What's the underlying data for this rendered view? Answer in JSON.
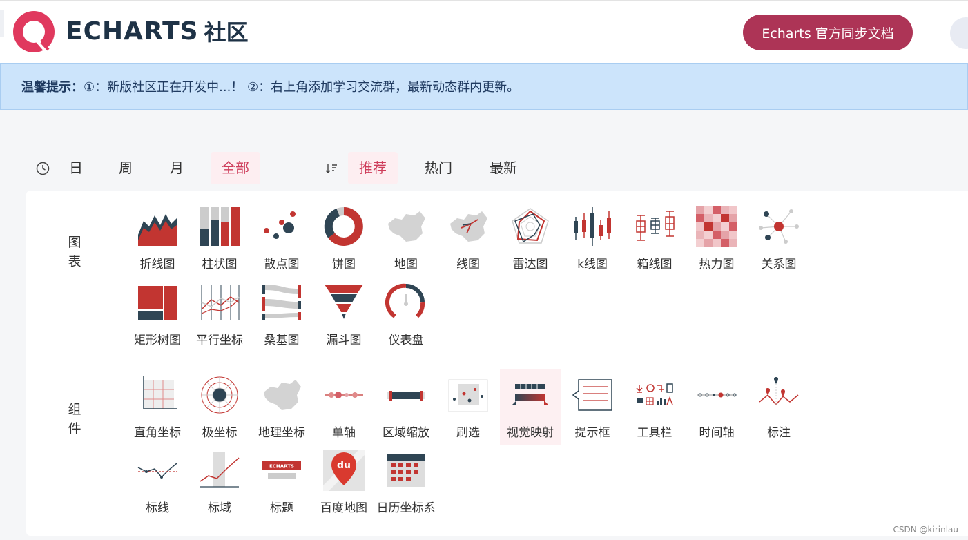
{
  "header": {
    "brand_word": "ECHARTS",
    "brand_cn": "社区",
    "docs_button": "Echarts 官方同步文档"
  },
  "notice": {
    "label": "温馨提示：",
    "text": "①：新版社区正在开发中...！ ②：右上角添加学习交流群，最新动态群内更新。"
  },
  "filters": {
    "time_icon": "clock-icon",
    "time": [
      "日",
      "周",
      "月",
      "全部"
    ],
    "time_active": "全部",
    "sort_icon": "sort-icon",
    "sort": [
      "推荐",
      "热门",
      "最新"
    ],
    "sort_active": "推荐"
  },
  "sections": {
    "charts": {
      "label": "图表",
      "items": [
        "折线图",
        "柱状图",
        "散点图",
        "饼图",
        "地图",
        "线图",
        "雷达图",
        "k线图",
        "箱线图",
        "热力图",
        "关系图",
        "矩形树图",
        "平行坐标",
        "桑基图",
        "漏斗图",
        "仪表盘"
      ]
    },
    "components": {
      "label": "组件",
      "items": [
        "直角坐标",
        "极坐标",
        "地理坐标",
        "单轴",
        "区域缩放",
        "刷选",
        "视觉映射",
        "提示框",
        "工具栏",
        "时间轴",
        "标注",
        "标线",
        "标域",
        "标题",
        "百度地图",
        "日历坐标系"
      ],
      "highlighted": "视觉映射"
    }
  },
  "icon_text": {
    "title_badge": "ECHARTS",
    "baidu_badge": "du"
  },
  "colors": {
    "accent": "#ad3456",
    "active_text": "#ce3c5a",
    "active_bg": "#fdeef1",
    "notice_bg": "#cce4fb",
    "chart_red": "#c23531",
    "chart_navy": "#2f4554"
  },
  "watermark": "CSDN @kirinlau"
}
